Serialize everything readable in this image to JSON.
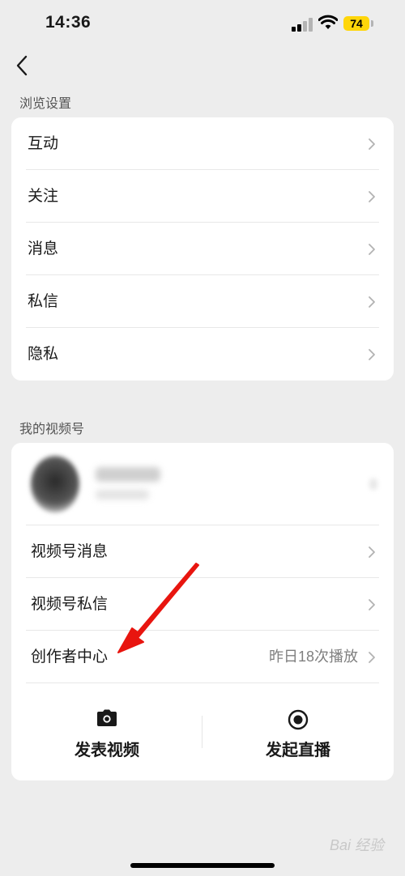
{
  "status_bar": {
    "time": "14:36",
    "battery": "74"
  },
  "browse_settings": {
    "title": "浏览设置",
    "items": [
      {
        "label": "互动"
      },
      {
        "label": "关注"
      },
      {
        "label": "消息"
      },
      {
        "label": "私信"
      },
      {
        "label": "隐私"
      }
    ]
  },
  "my_channel": {
    "title": "我的视频号",
    "items": [
      {
        "label": "视频号消息",
        "value": ""
      },
      {
        "label": "视频号私信",
        "value": ""
      },
      {
        "label": "创作者中心",
        "value": "昨日18次播放"
      }
    ],
    "actions": [
      {
        "label": "发表视频",
        "icon": "camera-icon"
      },
      {
        "label": "发起直播",
        "icon": "live-icon"
      }
    ]
  },
  "watermark": "Bai 经验",
  "colors": {
    "background": "#ededed",
    "card": "#ffffff",
    "annotation_arrow": "#e8150f",
    "battery": "#ffd60a"
  }
}
